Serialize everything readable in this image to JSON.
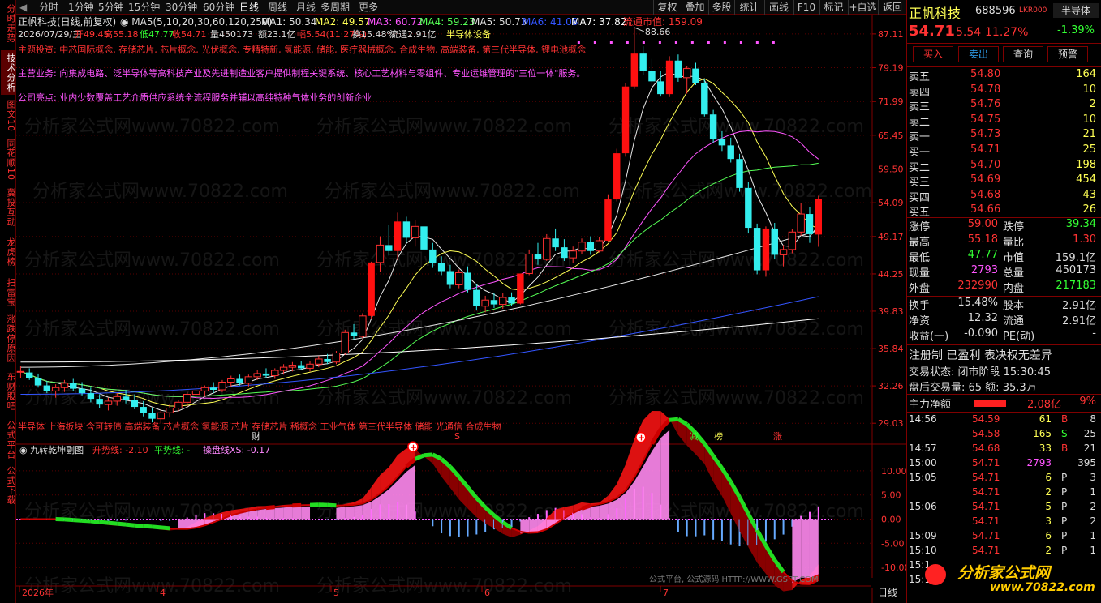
{
  "left_tabs": [
    "分时走势",
    "技术分析",
    "图文10",
    "同花顺10",
    "冀投互动",
    "龙虎榜",
    "扫雷宝",
    "涨跌停原因",
    "东财股吧",
    "公式平台",
    "公式下载"
  ],
  "periods": [
    "分时",
    "1分钟",
    "5分钟",
    "15分钟",
    "30分钟",
    "60分钟",
    "日线",
    "周线",
    "月线",
    "多周期",
    "更多"
  ],
  "selected_period": "日线",
  "toolbar": [
    "复权",
    "叠加",
    "多股",
    "统计",
    "画线",
    "F10",
    "标记",
    "+自选",
    "返回"
  ],
  "info": {
    "title": "正帆科技(日线,前复权)",
    "ma_label": "MA5(5,10,20,30,60,120,250)",
    "ma_values": [
      {
        "t": "MA1: 50.34",
        "c": "#e0e0e0"
      },
      {
        "t": "MA2: 49.57",
        "c": "#ffff55"
      },
      {
        "t": "MA3: 60.72",
        "c": "#ff55ff"
      },
      {
        "t": "MA4: 59.23",
        "c": "#55ff55"
      },
      {
        "t": "MA5: 50.73",
        "c": "#e0e0e0"
      },
      {
        "t": "MA6: 41.08",
        "c": "#3355ff"
      },
      {
        "t": "MA7: 37.82",
        "c": "#ffffff"
      },
      {
        "t": "流通市值: 159.09",
        "c": "#ff3333"
      }
    ],
    "ohlc": [
      "2026/07/29/三",
      "开49.45",
      "高55.18",
      "低47.77",
      "收54.71",
      "量450173",
      "额23.1亿",
      "幅5.54(11.27%)",
      "换15.48%",
      "流通2.91亿",
      "半导体设备"
    ],
    "concept": "主题投资: 中芯国际概念, 存储芯片, 芯片概念, 光伏概念, 专精特新, 氢能源, 储能, 医疗器械概念, 合成生物, 高端装备, 第三代半导体, 锂电池概念",
    "business": "主营业务: 向集成电路、泛半导体等高科技产业及先进制造业客户提供制程关键系统、核心工艺材料与零组件、专业运维管理的\"三位一体\"服务。",
    "highlight": "公司亮点: 业内少数覆盖工艺介质供应系统全流程服务并辅以高纯特种气体业务的创新企业",
    "sector": "半导体 上海板块 含可转债 高端装备 芯片概念 氢能源 芯片 存储芯片 稀概念 工业气体 第三代半导体 储能 光通信 合成生物",
    "high_mark": "88.66",
    "tags": [
      "财",
      "S",
      "减",
      "榜",
      "涨"
    ]
  },
  "sub": {
    "title": "九转乾坤副图",
    "l1": "升势线: -2.10",
    "l2": "平势线: -",
    "l3": "操盘线XS: -0.17"
  },
  "watermark": "分析家公式网www.70822.com",
  "footer": {
    "src": "公式平台, 公式源码 HTTP://WWW.GSPT.COM",
    "logo1": "分析家公式网",
    "logo2": "www.70822.com",
    "period": "日线"
  },
  "time_axis": [
    "2026年",
    "4",
    "5",
    "6",
    "7"
  ],
  "chart_data": {
    "type": "candlestick",
    "y_ticks": [
      87.11,
      79.19,
      71.99,
      65.45,
      59.5,
      54.09,
      49.17,
      44.25,
      39.83,
      35.84,
      32.26,
      29.03
    ],
    "sub_ticks": [
      10.0,
      5.0,
      0.0,
      -5.0,
      -10.0
    ],
    "candles": [
      [
        33.6,
        34.1,
        33.0,
        33.6
      ],
      [
        33.5,
        33.9,
        32.8,
        33.0
      ],
      [
        33.0,
        33.4,
        32.1,
        32.3
      ],
      [
        32.3,
        32.7,
        31.6,
        31.8
      ],
      [
        31.8,
        32.4,
        31.2,
        32.1
      ],
      [
        32.1,
        32.8,
        31.7,
        32.5
      ],
      [
        32.5,
        32.9,
        31.8,
        32.0
      ],
      [
        32.0,
        32.6,
        31.4,
        31.6
      ],
      [
        31.6,
        32.1,
        30.8,
        31.1
      ],
      [
        31.1,
        31.5,
        30.3,
        30.6
      ],
      [
        30.6,
        31.2,
        30.1,
        30.9
      ],
      [
        30.9,
        31.6,
        30.5,
        31.3
      ],
      [
        31.3,
        31.9,
        30.7,
        31.0
      ],
      [
        31.0,
        31.5,
        30.2,
        30.4
      ],
      [
        30.4,
        30.9,
        29.6,
        29.9
      ],
      [
        29.9,
        30.3,
        29.1,
        29.4
      ],
      [
        29.4,
        30.2,
        29.0,
        29.9
      ],
      [
        29.9,
        30.6,
        29.5,
        30.3
      ],
      [
        30.3,
        31.0,
        30.0,
        30.8
      ],
      [
        30.8,
        31.7,
        30.4,
        31.5
      ],
      [
        31.5,
        32.1,
        31.1,
        31.8
      ],
      [
        31.8,
        32.3,
        31.3,
        32.1
      ],
      [
        32.1,
        32.6,
        31.6,
        31.9
      ],
      [
        31.9,
        32.8,
        31.7,
        32.6
      ],
      [
        32.6,
        33.2,
        32.2,
        32.9
      ],
      [
        32.9,
        33.3,
        32.3,
        32.5
      ],
      [
        32.5,
        33.3,
        32.2,
        33.1
      ],
      [
        33.1,
        33.7,
        32.8,
        33.4
      ],
      [
        33.4,
        33.9,
        33.0,
        33.2
      ],
      [
        33.2,
        33.9,
        32.9,
        33.7
      ],
      [
        33.7,
        34.3,
        33.3,
        34.0
      ],
      [
        34.0,
        34.5,
        33.6,
        34.2
      ],
      [
        34.2,
        34.6,
        33.7,
        33.9
      ],
      [
        33.9,
        34.6,
        33.6,
        34.3
      ],
      [
        34.3,
        35.1,
        34.0,
        34.8
      ],
      [
        34.8,
        35.3,
        34.3,
        34.5
      ],
      [
        34.5,
        35.6,
        34.3,
        35.4
      ],
      [
        35.4,
        37.8,
        35.2,
        37.5
      ],
      [
        37.5,
        38.4,
        36.8,
        37.1
      ],
      [
        37.1,
        39.6,
        36.9,
        39.3
      ],
      [
        39.3,
        45.8,
        39.0,
        45.7
      ],
      [
        45.7,
        49.2,
        44.5,
        48.0
      ],
      [
        48.0,
        50.8,
        46.6,
        47.2
      ],
      [
        47.2,
        52.6,
        46.0,
        51.3
      ],
      [
        51.3,
        52.0,
        48.3,
        49.0
      ],
      [
        49.0,
        51.5,
        47.8,
        50.6
      ],
      [
        50.6,
        51.9,
        47.1,
        47.4
      ],
      [
        47.4,
        48.3,
        45.0,
        45.6
      ],
      [
        45.6,
        46.5,
        44.1,
        44.6
      ],
      [
        44.6,
        45.4,
        42.5,
        42.9
      ],
      [
        42.9,
        44.8,
        42.5,
        44.4
      ],
      [
        44.4,
        45.2,
        42.0,
        42.3
      ],
      [
        42.3,
        43.0,
        39.9,
        40.4
      ],
      [
        40.4,
        41.6,
        39.7,
        41.1
      ],
      [
        41.1,
        41.9,
        40.2,
        40.6
      ],
      [
        40.6,
        41.9,
        40.1,
        41.4
      ],
      [
        41.4,
        42.0,
        40.4,
        40.7
      ],
      [
        40.7,
        44.3,
        40.6,
        44.3
      ],
      [
        44.3,
        47.4,
        44.1,
        46.8
      ],
      [
        46.8,
        48.3,
        45.4,
        46.1
      ],
      [
        46.1,
        49.5,
        45.9,
        48.9
      ],
      [
        48.9,
        50.3,
        47.2,
        47.7
      ],
      [
        47.7,
        48.8,
        45.9,
        46.3
      ],
      [
        46.3,
        47.8,
        45.6,
        47.2
      ],
      [
        47.2,
        48.9,
        46.8,
        48.4
      ],
      [
        48.4,
        49.2,
        46.7,
        47.2
      ],
      [
        47.2,
        49.1,
        47.0,
        48.6
      ],
      [
        48.6,
        55.4,
        48.4,
        54.6
      ],
      [
        54.6,
        63.0,
        54.3,
        62.2
      ],
      [
        62.2,
        75.8,
        61.6,
        75.1
      ],
      [
        75.1,
        88.7,
        74.6,
        82.4
      ],
      [
        82.4,
        84.1,
        77.6,
        78.5
      ],
      [
        78.5,
        81.2,
        75.0,
        76.2
      ],
      [
        76.2,
        78.5,
        73.0,
        73.5
      ],
      [
        73.5,
        81.8,
        72.9,
        80.8
      ],
      [
        80.8,
        82.2,
        76.1,
        77.0
      ],
      [
        77.0,
        79.6,
        73.6,
        79.0
      ],
      [
        79.0,
        80.3,
        75.4,
        75.9
      ],
      [
        75.9,
        76.6,
        69.0,
        69.4
      ],
      [
        69.4,
        70.3,
        64.1,
        64.8
      ],
      [
        64.8,
        66.2,
        62.6,
        63.6
      ],
      [
        63.6,
        65.0,
        60.6,
        61.2
      ],
      [
        61.2,
        62.1,
        55.8,
        56.4
      ],
      [
        56.4,
        57.3,
        49.6,
        50.4
      ],
      [
        50.4,
        51.0,
        44.2,
        44.7
      ],
      [
        44.7,
        50.6,
        43.9,
        50.3
      ],
      [
        50.3,
        51.1,
        46.1,
        46.7
      ],
      [
        46.7,
        48.0,
        45.2,
        47.4
      ],
      [
        47.4,
        50.2,
        46.9,
        49.8
      ],
      [
        49.8,
        54.1,
        49.3,
        52.4
      ],
      [
        52.4,
        53.4,
        48.3,
        49.5
      ],
      [
        49.45,
        55.18,
        47.77,
        54.71
      ]
    ]
  },
  "quote": {
    "name": "正帆科技",
    "code": "688596",
    "flag": "LKR000",
    "sector": "半导体",
    "sector_pct": "-1.39%",
    "price": "54.71",
    "chg": "5.54",
    "pct": "11.27%",
    "buttons": [
      "买入",
      "卖出",
      "查询",
      "预警"
    ],
    "asks": [
      [
        "卖五",
        "54.80",
        "164"
      ],
      [
        "卖四",
        "54.78",
        "10"
      ],
      [
        "卖三",
        "54.76",
        "2"
      ],
      [
        "卖二",
        "54.75",
        "10"
      ],
      [
        "卖一",
        "54.73",
        "21"
      ]
    ],
    "bids": [
      [
        "买一",
        "54.71",
        "25"
      ],
      [
        "买二",
        "54.70",
        "198"
      ],
      [
        "买三",
        "54.69",
        "454"
      ],
      [
        "买四",
        "54.68",
        "43"
      ],
      [
        "买五",
        "54.66",
        "26"
      ]
    ],
    "stats": [
      [
        "涨停",
        "59.00",
        "跌停",
        "39.34"
      ],
      [
        "最高",
        "55.18",
        "量比",
        "1.30"
      ],
      [
        "最低",
        "47.77",
        "市值",
        "159.1亿"
      ],
      [
        "现量",
        "2793",
        "总量",
        "450173"
      ],
      [
        "外盘",
        "232990",
        "内盘",
        "217183"
      ]
    ],
    "fin": [
      [
        "换手",
        "15.48%",
        "股本",
        "2.91亿"
      ],
      [
        "净资",
        "12.32",
        "流通",
        "2.91亿"
      ],
      [
        "收益(一)",
        "-0.090",
        "PE(动)",
        "-"
      ]
    ],
    "reg": "注册制 已盈利 表决权无差异",
    "status": "交易状态: 闭市阶段 15:30:45",
    "after": "盘后交易量: 65 额: 35.3万",
    "netflow_label": "主力净额",
    "netflow_val": "2.08亿",
    "netflow_pct": "9%",
    "ticks": [
      [
        "14:56",
        "54.59",
        "61",
        "B",
        "8"
      ],
      [
        "",
        "54.58",
        "165",
        "S",
        "25"
      ],
      [
        "14:57",
        "54.68",
        "33",
        "B",
        "21"
      ],
      [
        "15:00",
        "54.71",
        "2793",
        "",
        "395"
      ],
      [
        "15:05",
        "54.71",
        "6",
        "P",
        "3"
      ],
      [
        "",
        "54.71",
        "2",
        "P",
        "1"
      ],
      [
        "15:06",
        "54.71",
        "5",
        "P",
        "2"
      ],
      [
        "",
        "54.71",
        "3",
        "P",
        "2"
      ],
      [
        "15:09",
        "54.71",
        "6",
        "P",
        "1"
      ],
      [
        "15:10",
        "54.71",
        "2",
        "P",
        "1"
      ],
      [
        "15:1",
        "",
        "",
        "",
        ""
      ],
      [
        "15:1",
        "",
        "",
        "",
        ""
      ]
    ]
  }
}
